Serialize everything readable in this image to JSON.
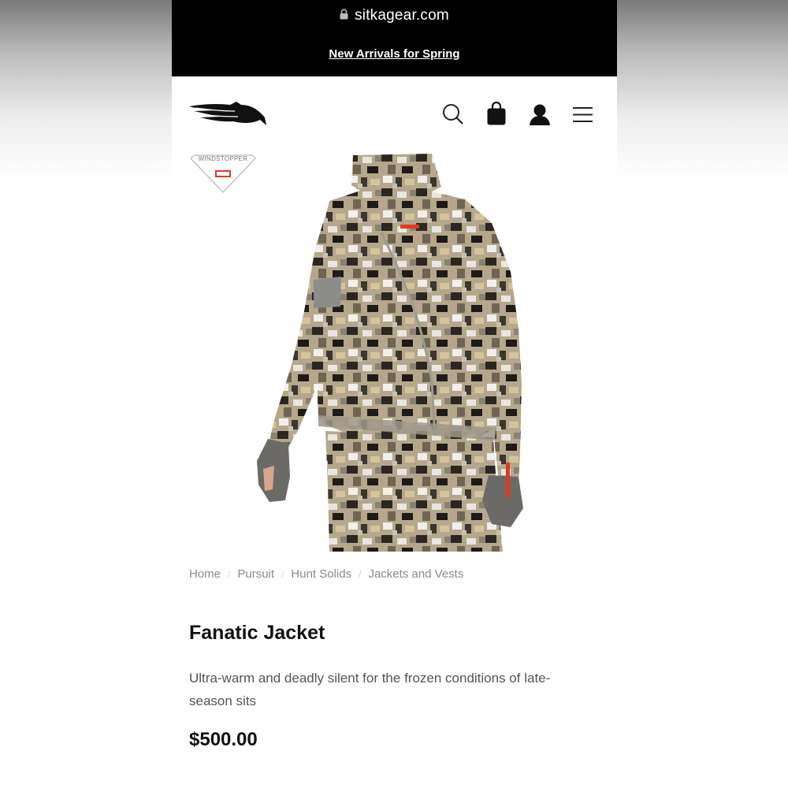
{
  "browser": {
    "url": "sitkagear.com"
  },
  "promo": {
    "text": "New Arrivals for Spring"
  },
  "header": {
    "brand": "SITKA",
    "icons": [
      "search-icon",
      "bag-icon",
      "account-icon",
      "menu-icon"
    ]
  },
  "badge": {
    "label": "WINDSTOPPER",
    "sub": "GORE"
  },
  "breadcrumb": [
    "Home",
    "Pursuit",
    "Hunt Solids",
    "Jackets and Vests"
  ],
  "product": {
    "title": "Fanatic Jacket",
    "description": "Ultra-warm and deadly silent for the frozen conditions of late-season sits",
    "price": "$500.00"
  },
  "colors": {
    "topbar": "#000000",
    "text": "#111111",
    "muted": "#8a8a8a",
    "accent": "#e03a1e"
  }
}
